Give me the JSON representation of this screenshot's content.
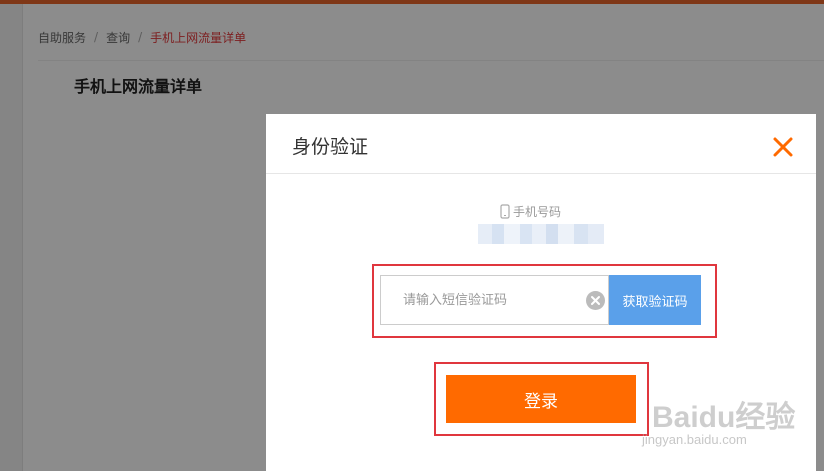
{
  "breadcrumb": {
    "items": [
      "自助服务",
      "查询"
    ],
    "current": "手机上网流量详单",
    "separator": "/"
  },
  "panel": {
    "title": "手机上网流量详单"
  },
  "modal": {
    "title": "身份验证",
    "phone_label": "手机号码",
    "code_placeholder": "请输入短信验证码",
    "get_code_label": "获取验证码",
    "login_label": "登录"
  },
  "watermark": {
    "brand": "Baidu经验",
    "url": "jingyan.baidu.com"
  },
  "icons": {
    "close": "close-icon",
    "clear": "clear-icon",
    "phone": "phone-icon"
  },
  "colors": {
    "accent_orange": "#ff6a00",
    "top_bar": "#e8642a",
    "breadcrumb_current": "#e4393c",
    "get_code_button": "#5aa0ea",
    "highlight_border": "#e0363e"
  }
}
